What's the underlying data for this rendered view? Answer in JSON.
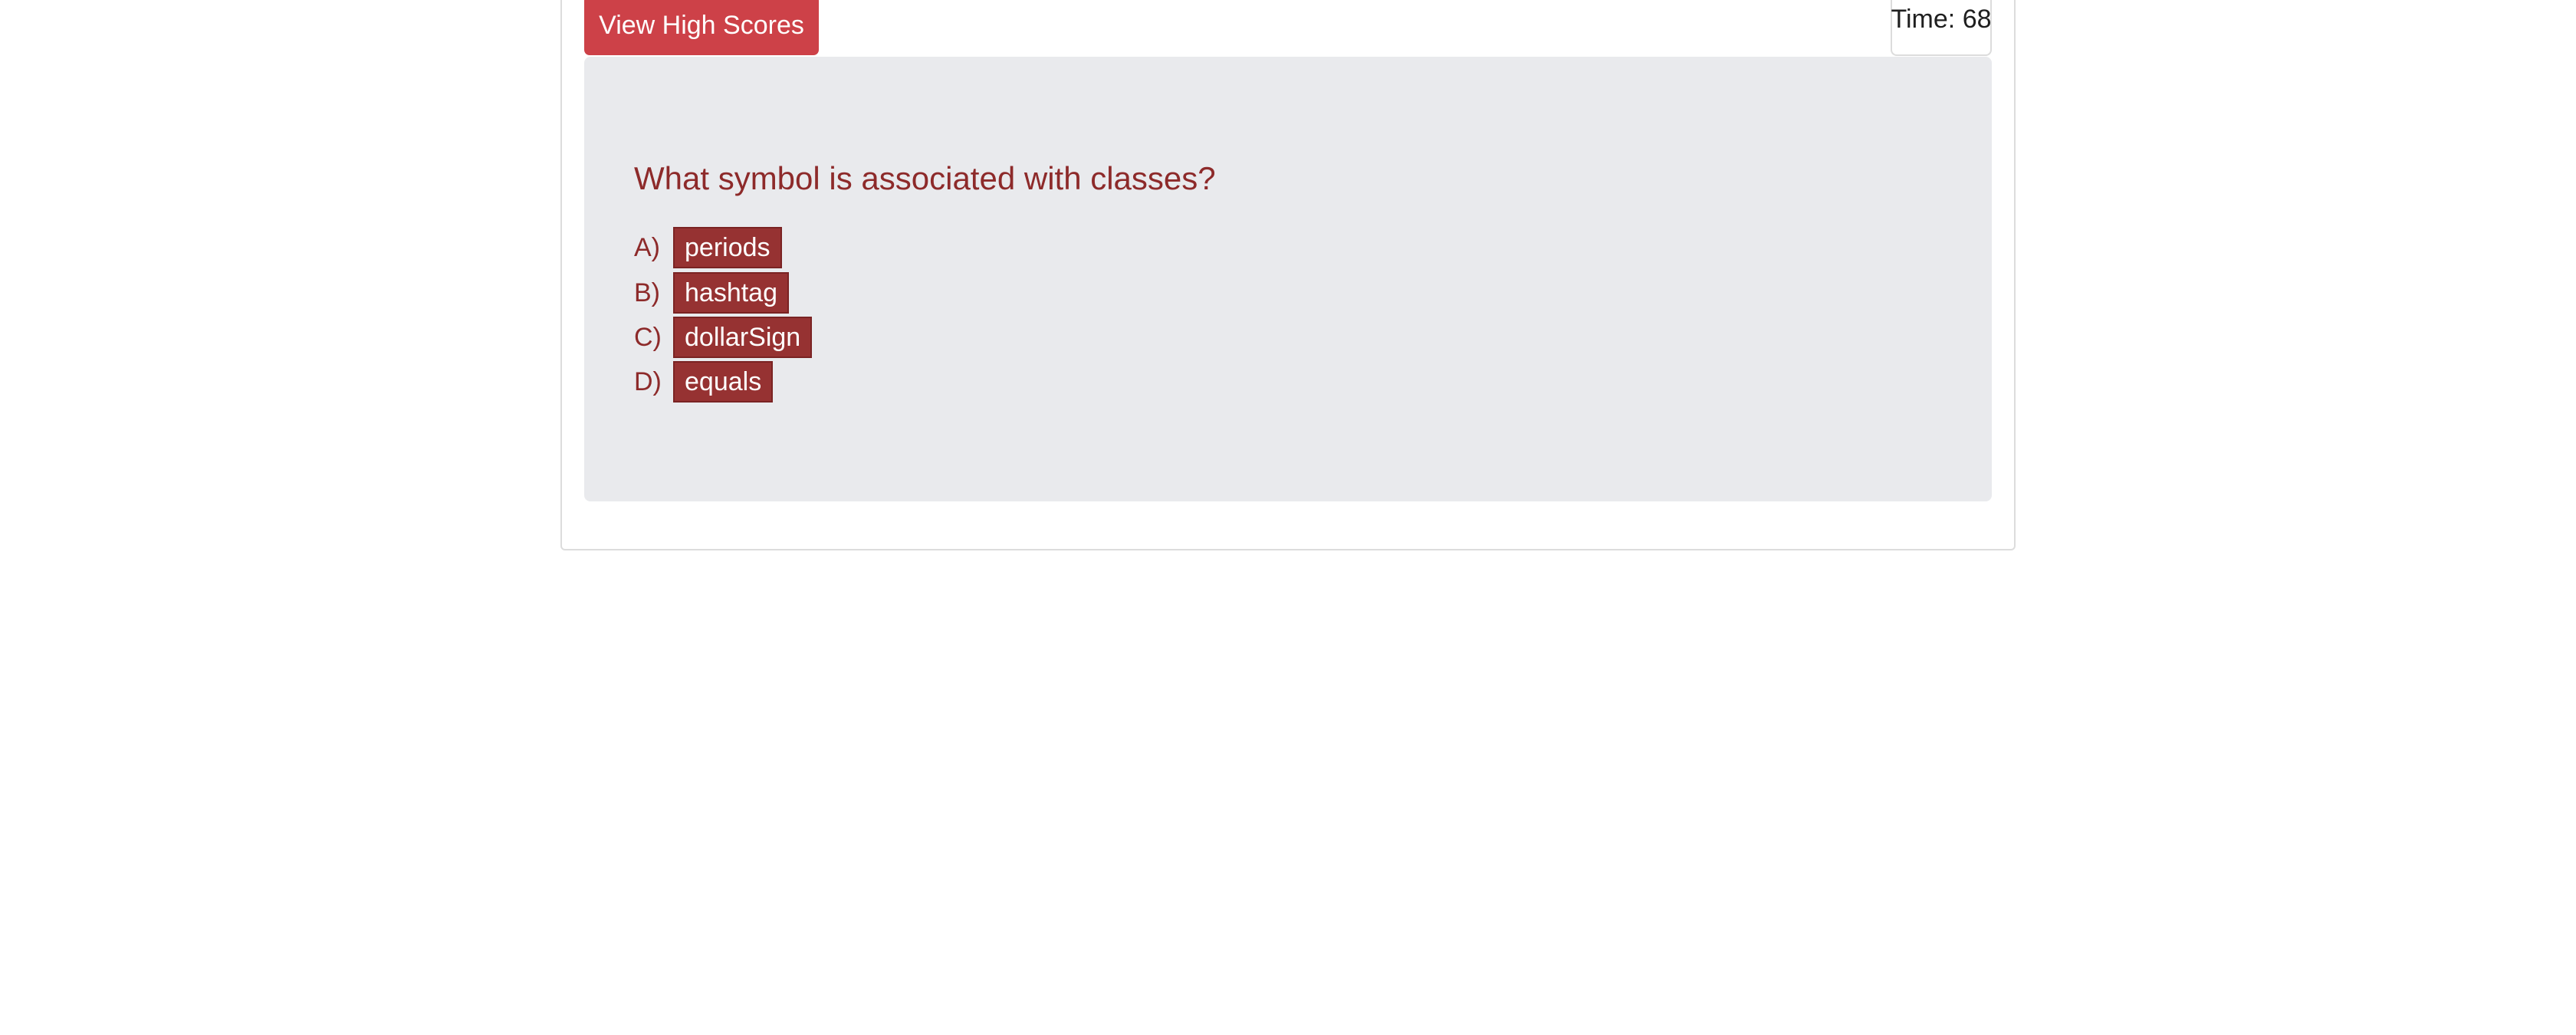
{
  "header": {
    "high_scores_label": "View High Scores",
    "timer_label": "Time:",
    "timer_value": "68"
  },
  "quiz": {
    "question": "What symbol is associated with classes?",
    "choices": [
      {
        "letter": "A)",
        "text": "periods"
      },
      {
        "letter": "B)",
        "text": "hashtag"
      },
      {
        "letter": "C)",
        "text": "dollarSign"
      },
      {
        "letter": "D)",
        "text": "equals"
      }
    ]
  },
  "colors": {
    "high_scores_button": "#cd4148",
    "answer_button": "#963232",
    "question_text": "#8d2a2a",
    "panel_background": "#e9eaed"
  }
}
